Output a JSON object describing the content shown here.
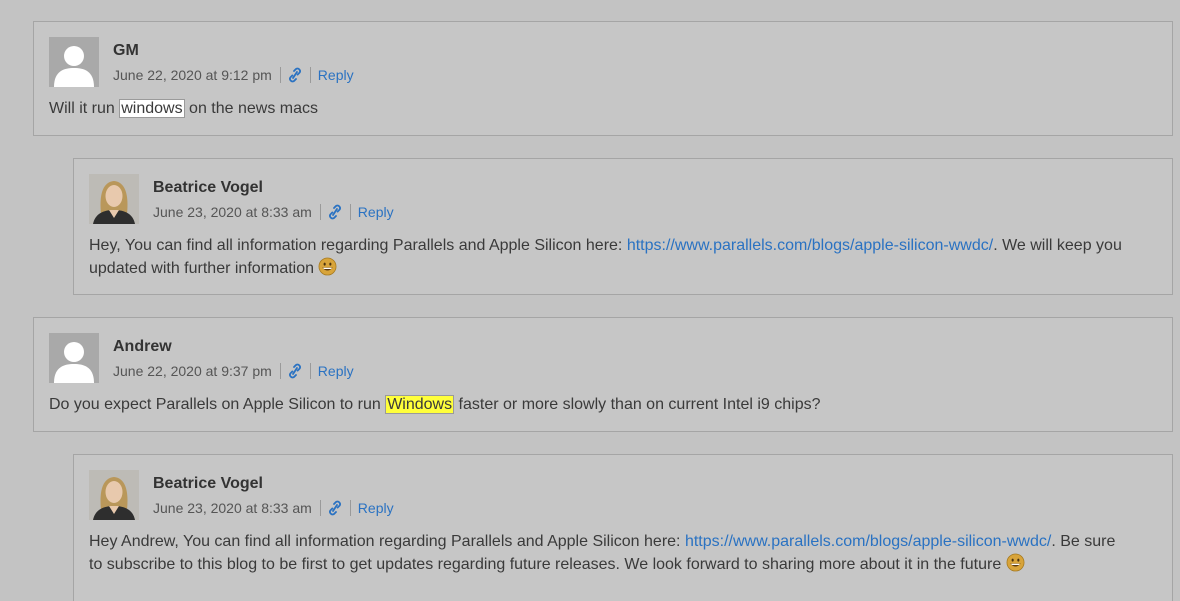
{
  "comments": [
    {
      "author": "GM",
      "date": "June 22, 2020 at 9:12 pm",
      "reply_label": "Reply",
      "text_before": "Will it run ",
      "highlight": "windows",
      "text_after": " on the news macs"
    },
    {
      "author": "Beatrice Vogel",
      "date": "June 23, 2020 at 8:33 am",
      "reply_label": "Reply",
      "text_before": "Hey, You can find all information regarding Parallels and Apple Silicon here: ",
      "link": "https://www.parallels.com/blogs/apple-silicon-wwdc/",
      "text_after": ". We will keep you updated with further information"
    },
    {
      "author": "Andrew",
      "date": "June 22, 2020 at 9:37 pm",
      "reply_label": "Reply",
      "text_before": "Do you expect Parallels on Apple Silicon to run ",
      "highlight": "Windows",
      "text_after": " faster or more slowly than on current Intel i9 chips?"
    },
    {
      "author": "Beatrice Vogel",
      "date": "June 23, 2020 at 8:33 am",
      "reply_label": "Reply",
      "text_before": "Hey Andrew, You can find all information regarding Parallels and Apple Silicon here: ",
      "link": "https://www.parallels.com/blogs/apple-silicon-wwdc/",
      "text_after": ". Be sure to subscribe to this blog to be first to get updates regarding future releases. We look forward to sharing more about it in the future"
    }
  ],
  "colors": {
    "link": "#2a72c2",
    "highlight_yellow": "#ffff3a",
    "background": "#c3c3c3"
  },
  "icons": [
    "default-avatar-icon",
    "permalink-icon",
    "grinning-emoji-icon"
  ]
}
